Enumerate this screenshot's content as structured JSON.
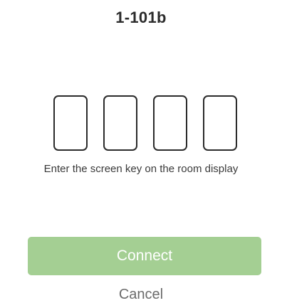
{
  "header": {
    "room_name": "1-101b"
  },
  "key_entry": {
    "fields": [
      {
        "value": "",
        "placeholder": ""
      },
      {
        "value": "",
        "placeholder": ""
      },
      {
        "value": "",
        "placeholder": ""
      },
      {
        "value": "",
        "placeholder": ""
      }
    ],
    "hint": "Enter the screen key on the room display"
  },
  "actions": {
    "connect_label": "Connect",
    "cancel_label": "Cancel"
  },
  "colors": {
    "connect_button_bg": "#a4cf93",
    "connect_button_text": "#ffffff",
    "key_box_border": "#2b2b2b",
    "cancel_text": "#6b6b6b"
  }
}
